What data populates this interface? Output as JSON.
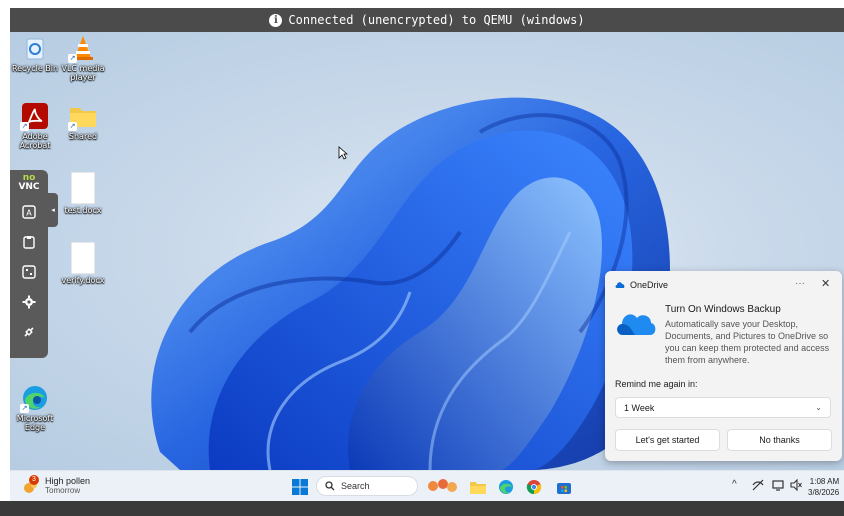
{
  "vnc": {
    "banner": "Connected (unencrypted) to QEMU (windows)",
    "panel_logo_top": "no",
    "panel_logo_bottom": "VNC"
  },
  "desktop_icons": [
    {
      "name": "recycle-bin",
      "label": "Recycle Bin"
    },
    {
      "name": "vlc",
      "label": "VLC media\nplayer"
    },
    {
      "name": "adobe",
      "label": "Adobe\nAcrobat"
    },
    {
      "name": "shared",
      "label": "Shared"
    },
    {
      "name": "testdocx",
      "label": "test.docx"
    },
    {
      "name": "verifydocx",
      "label": "verify.docx"
    },
    {
      "name": "edge",
      "label": "Microsoft\nEdge"
    }
  ],
  "onedrive_toast": {
    "app_name": "OneDrive",
    "more": "···",
    "close": "✕",
    "title": "Turn On Windows Backup",
    "body": "Automatically save your Desktop, Documents, and Pictures to OneDrive so you can keep them protected and access them from anywhere.",
    "remind_label": "Remind me again in:",
    "remind_value": "1 Week",
    "primary_button": "Let's get started",
    "secondary_button": "No thanks"
  },
  "taskbar": {
    "weather_title": "High pollen",
    "weather_sub": "Tomorrow",
    "weather_badge": "3",
    "search_placeholder": "Search",
    "time": "1:08 AM",
    "date": "3/8/2026"
  },
  "colors": {
    "accent": "#0067c0",
    "wallpaper_blue": "#1f5fe0",
    "taskbar": "#ecf1f7",
    "vnc_bar": "#4b4b4b"
  }
}
